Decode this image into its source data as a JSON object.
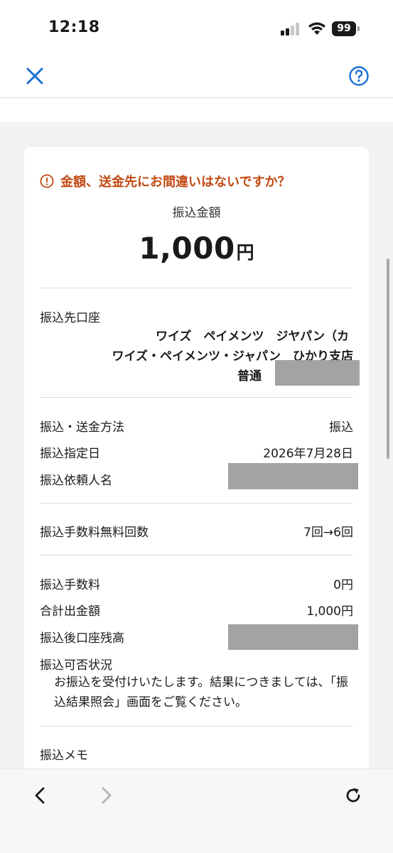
{
  "status_bar": {
    "time": "12:18",
    "battery": "99"
  },
  "header": {
    "close_icon": "close-icon",
    "help_icon": "help-icon"
  },
  "confirm": {
    "warning": "金額、送金先にお間違いはないですか？",
    "amount_label": "振込金額",
    "amount_value": "1,000",
    "amount_unit": "円"
  },
  "destination": {
    "label": "振込先口座",
    "line1": "ワイズ　ペイメンツ　ジヤパン（カ",
    "line2": "ワイズ・ペイメンツ・ジャパン　ひかり支店",
    "account_type": "普通"
  },
  "details": [
    {
      "label": "振込・送金方法",
      "value": "振込"
    },
    {
      "label": "振込指定日",
      "value": "2026年7月28日"
    },
    {
      "label": "振込依頼人名",
      "value": ""
    }
  ],
  "free_count": {
    "label": "振込手数料無料回数",
    "value": "7回→6回"
  },
  "fees": [
    {
      "label": "振込手数料",
      "value": "0円"
    },
    {
      "label": "合計出金額",
      "value": "1,000円"
    },
    {
      "label": "振込後口座残高",
      "value": ""
    }
  ],
  "status": {
    "label": "振込可否状況",
    "note": "お振込を受付けいたします。結果につきましては、「振込結果照会」画面をご覧ください。"
  },
  "memo": {
    "label": "振込メモ"
  },
  "colors": {
    "accent": "#1a6fd1",
    "warning": "#c14a12",
    "mask": "#a3a3a3"
  }
}
